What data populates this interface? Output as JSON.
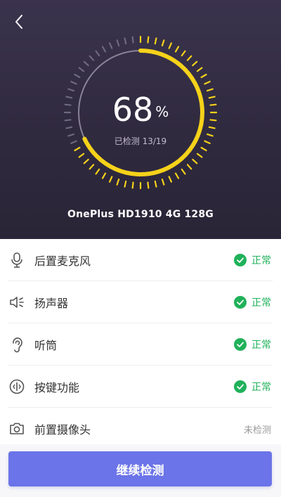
{
  "header": {
    "percent_value": "68",
    "percent_unit": "%",
    "progress_label": "已检测 13/19",
    "device_name": "OnePlus HD1910 4G 128G"
  },
  "gauge": {
    "progress": 0.68,
    "arc_color": "#f5d21a",
    "track_color": "#8a8498",
    "tick_done_color": "#f5d21a",
    "tick_todo_color": "#6e6880"
  },
  "items": [
    {
      "label": "后置麦克风",
      "status": "正常",
      "state": "ok",
      "icon": "microphone-icon"
    },
    {
      "label": "扬声器",
      "status": "正常",
      "state": "ok",
      "icon": "speaker-icon"
    },
    {
      "label": "听筒",
      "status": "正常",
      "state": "ok",
      "icon": "ear-icon"
    },
    {
      "label": "按键功能",
      "status": "正常",
      "state": "ok",
      "icon": "key-icon"
    },
    {
      "label": "前置摄像头",
      "status": "未检测",
      "state": "pending",
      "icon": "camera-icon"
    }
  ],
  "footer": {
    "continue_label": "继续检测"
  },
  "colors": {
    "ok": "#20b15a",
    "pending": "#9a9a9a",
    "button": "#6b74e8"
  }
}
